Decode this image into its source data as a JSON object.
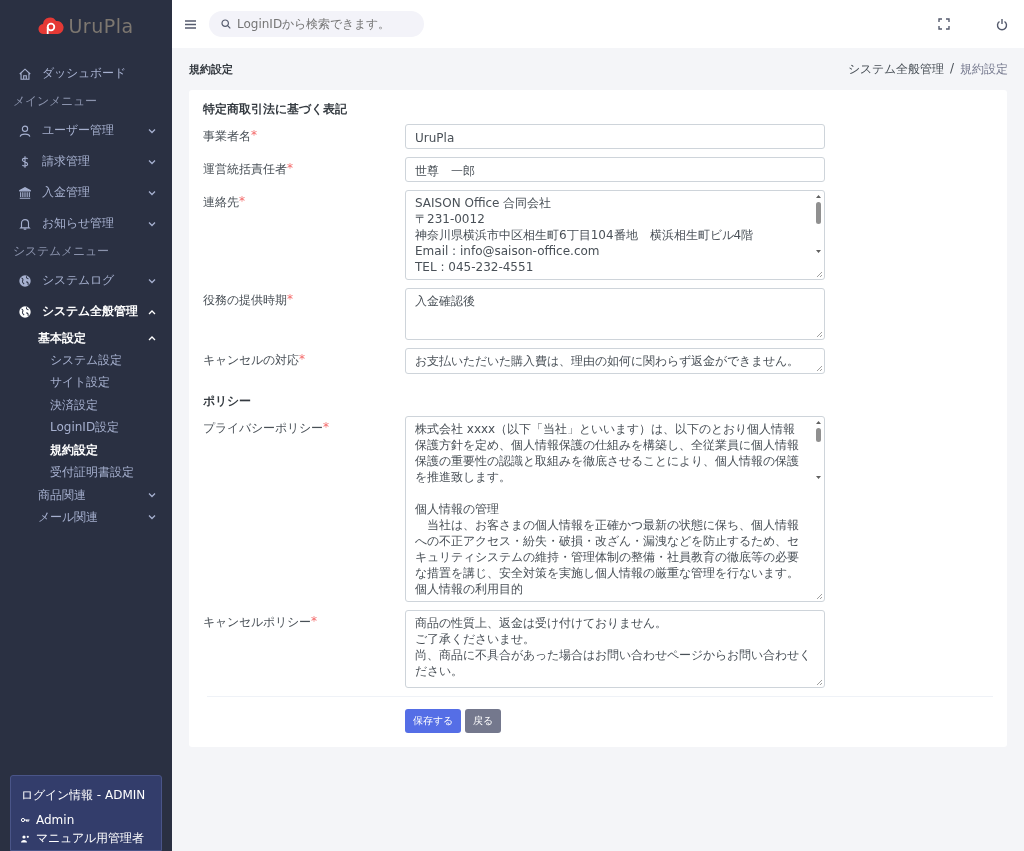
{
  "brand": {
    "name": "UruPla"
  },
  "sidebar": {
    "items": [
      {
        "kind": "item",
        "label": "ダッシュボード",
        "expanded": false
      },
      {
        "kind": "heading",
        "label": "メインメニュー"
      },
      {
        "kind": "item",
        "label": "ユーザー管理",
        "expanded": false
      },
      {
        "kind": "item",
        "label": "請求管理",
        "expanded": false
      },
      {
        "kind": "item",
        "label": "入金管理",
        "expanded": false
      },
      {
        "kind": "item",
        "label": "お知らせ管理",
        "expanded": false
      },
      {
        "kind": "heading",
        "label": "システムメニュー"
      },
      {
        "kind": "item",
        "label": "システムログ",
        "expanded": false
      },
      {
        "kind": "item",
        "label": "システム全般管理",
        "expanded": true,
        "children": [
          {
            "label": "基本設定",
            "expanded": true,
            "children": [
              {
                "label": "システム設定",
                "selected": false
              },
              {
                "label": "サイト設定",
                "selected": false
              },
              {
                "label": "決済設定",
                "selected": false
              },
              {
                "label": "LoginID設定",
                "selected": false
              },
              {
                "label": "規約設定",
                "selected": true
              },
              {
                "label": "受付証明書設定",
                "selected": false
              }
            ]
          },
          {
            "label": "商品関連",
            "expanded": false
          },
          {
            "label": "メール関連",
            "expanded": false
          }
        ]
      }
    ]
  },
  "login_info": {
    "title": "ログイン情報 - ADMIN",
    "login_id": "Admin",
    "user_name": "マニュアル用管理者"
  },
  "topbar": {
    "search": {
      "placeholder": "LoginIDから検索できます。"
    }
  },
  "page": {
    "title": "規約設定",
    "breadcrumb": {
      "items": [
        "システム全般管理",
        "規約設定"
      ],
      "separator": "/"
    }
  },
  "sections": [
    {
      "title": "特定商取引法に基づく表記",
      "fields": [
        {
          "label": "事業者名",
          "required_mark": "*",
          "kind": "input",
          "lines": [
            {
              "text": "UruPla"
            }
          ]
        },
        {
          "label": "運営統括責任者",
          "required_mark": "*",
          "kind": "input",
          "lines": [
            {
              "text": "世尊　一郎"
            }
          ]
        },
        {
          "label": "連絡先",
          "required_mark": "*",
          "kind": "scroll-textarea",
          "lines": [
            {
              "text": "SAISON Office 合同会社"
            },
            {
              "text": "〒231-0012"
            },
            {
              "text": "神奈川県横浜市中区相生町6丁目104番地　横浜相生町ビル4階"
            },
            {
              "text": "Email : info@saison-office.com"
            },
            {
              "text": "TEL : 045-232-4551"
            }
          ]
        },
        {
          "label": "役務の提供時期",
          "required_mark": "*",
          "kind": "textarea",
          "lines": [
            {
              "text": "入金確認後"
            }
          ]
        },
        {
          "label": "キャンセルの対応",
          "required_mark": "*",
          "kind": "textarea-short",
          "lines": [
            {
              "text": "お支払いただいた購入費は、理由の如何に関わらず返金ができません。"
            }
          ]
        }
      ]
    },
    {
      "title": "ポリシー",
      "fields": [
        {
          "label": "プライバシーポリシー",
          "required_mark": "*",
          "kind": "scroll-textarea",
          "lines": [
            {
              "text": "株式会社 xxxx（以下「当社」といいます）は、以下のとおり個人情報保護方針を定め、個人情報保護の仕組みを構築し、全従業員に個人情報保護の重要性の認識と取組みを徹底させることにより、個人情報の保護を推進致します。"
            },
            {
              "text": "個人情報の管理",
              "spaced": true
            },
            {
              "text": "　当社は、お客さまの個人情報を正確かつ最新の状態に保ち、個人情報への不正アクセス・紛失・破損・改ざん・漏洩などを防止するため、セキュリティシステムの維持・管理体制の整備・社員教育の徹底等の必要な措置を講じ、安全対策を実施し個人情報の厳重な管理を行ないます。"
            },
            {
              "text": "個人情報の利用目的"
            }
          ]
        },
        {
          "label": "キャンセルポリシー",
          "required_mark": "*",
          "kind": "textarea-tall",
          "lines": [
            {
              "text": "商品の性質上、返金は受け付けておりません。"
            },
            {
              "text": "ご了承くださいませ。"
            },
            {
              "text": "尚、商品に不具合があった場合はお問い合わせページからお問い合わせください。"
            }
          ]
        }
      ]
    }
  ],
  "buttons": [
    {
      "label": "保存する",
      "kind": "primary"
    },
    {
      "label": "戻る",
      "kind": "secondary"
    }
  ]
}
